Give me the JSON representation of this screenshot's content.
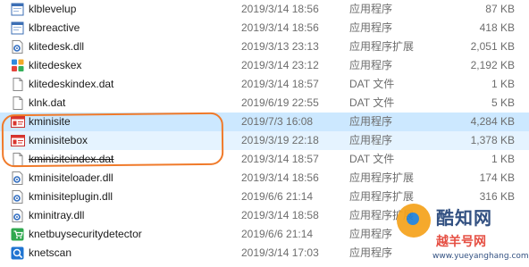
{
  "files": [
    {
      "name": "klblevelup",
      "date": "2019/3/14 18:56",
      "type": "应用程序",
      "size": "87 KB",
      "icon": "app-window-icon"
    },
    {
      "name": "klbreactive",
      "date": "2019/3/14 18:56",
      "type": "应用程序",
      "size": "418 KB",
      "icon": "app-window-icon"
    },
    {
      "name": "klitedesk.dll",
      "date": "2019/3/13 23:13",
      "type": "应用程序扩展",
      "size": "2,051 KB",
      "icon": "dll-gear-icon"
    },
    {
      "name": "klitedeskex",
      "date": "2019/3/14 23:12",
      "type": "应用程序",
      "size": "2,192 KB",
      "icon": "color-grid-app-icon"
    },
    {
      "name": "klitedeskindex.dat",
      "date": "2019/3/14 18:57",
      "type": "DAT 文件",
      "size": "1 KB",
      "icon": "blank-file-icon"
    },
    {
      "name": "klnk.dat",
      "date": "2019/6/19 22:55",
      "type": "DAT 文件",
      "size": "5 KB",
      "icon": "blank-file-icon"
    },
    {
      "name": "kminisite",
      "date": "2019/7/3 16:08",
      "type": "应用程序",
      "size": "4,284 KB",
      "icon": "red-window-app-icon"
    },
    {
      "name": "kminisitebox",
      "date": "2019/3/19 22:18",
      "type": "应用程序",
      "size": "1,378 KB",
      "icon": "red-window-app-icon"
    },
    {
      "name": "kminisiteindex.dat",
      "date": "2019/3/14 18:57",
      "type": "DAT 文件",
      "size": "1 KB",
      "icon": "blank-file-icon"
    },
    {
      "name": "kminisiteloader.dll",
      "date": "2019/3/14 18:56",
      "type": "应用程序扩展",
      "size": "174 KB",
      "icon": "dll-gear-icon"
    },
    {
      "name": "kminisiteplugin.dll",
      "date": "2019/6/6 21:14",
      "type": "应用程序扩展",
      "size": "316 KB",
      "icon": "dll-gear-icon"
    },
    {
      "name": "kminitray.dll",
      "date": "2019/3/14 18:58",
      "type": "应用程序扩展",
      "size": "",
      "icon": "dll-gear-icon"
    },
    {
      "name": "knetbuysecuritydetector",
      "date": "2019/6/6 21:14",
      "type": "应用程序",
      "size": "",
      "icon": "green-cart-app-icon"
    },
    {
      "name": "knetscan",
      "date": "2019/3/14 17:03",
      "type": "应用程序",
      "size": "",
      "icon": "blue-scan-app-icon"
    }
  ],
  "selected_index": 6,
  "hover_index": 7,
  "watermark": {
    "title": "酷知网",
    "subtitle": "越羊号网",
    "url": "www.yueyanghang.com"
  },
  "colors": {
    "selected_bg": "#cce8ff",
    "hover_bg": "#e5f3ff",
    "annotation": "#f07a2a",
    "meta_text": "#6d6d6d"
  }
}
